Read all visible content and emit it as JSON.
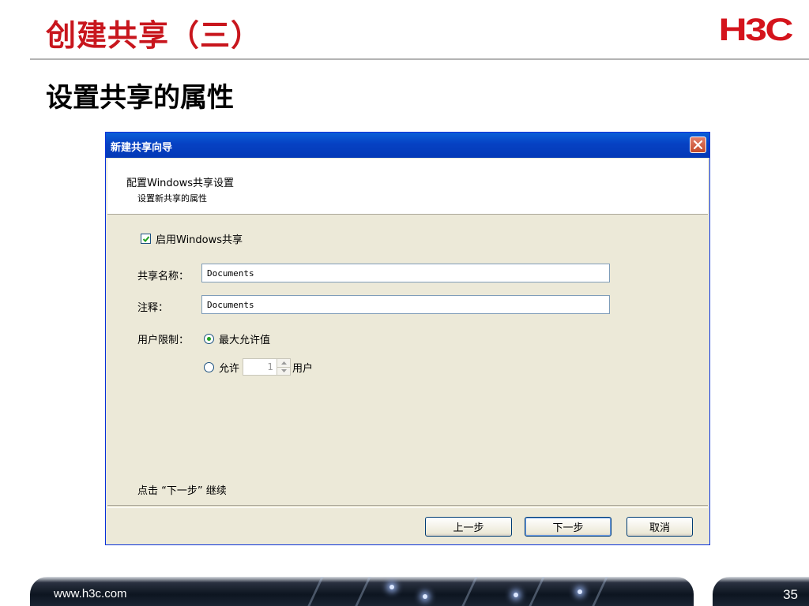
{
  "slide": {
    "title": "创建共享（三）",
    "subtitle": "设置共享的属性",
    "logo": "H3C",
    "url": "www.h3c.com",
    "page_number": "35"
  },
  "dialog": {
    "title": "新建共享向导",
    "header_title": "配置Windows共享设置",
    "header_subtitle": "设置新共享的属性",
    "enable_sharing": {
      "label": "启用Windows共享",
      "checked": true
    },
    "share_name": {
      "label": "共享名称：",
      "value": "Documents"
    },
    "comment": {
      "label": "注释：",
      "value": "Documents"
    },
    "user_limit": {
      "label": "用户限制：",
      "option_max": "最大允许值",
      "option_allow": "允许",
      "allow_count": "1",
      "allow_unit": "用户",
      "selected": "max"
    },
    "hint": "点击 “下一步” 继续",
    "buttons": {
      "back": "上一步",
      "next": "下一步",
      "cancel": "取消"
    }
  },
  "colors": {
    "title_red": "#c8161d",
    "titlebar_blue": "#0641c3",
    "dialog_bg": "#ece9d8"
  }
}
